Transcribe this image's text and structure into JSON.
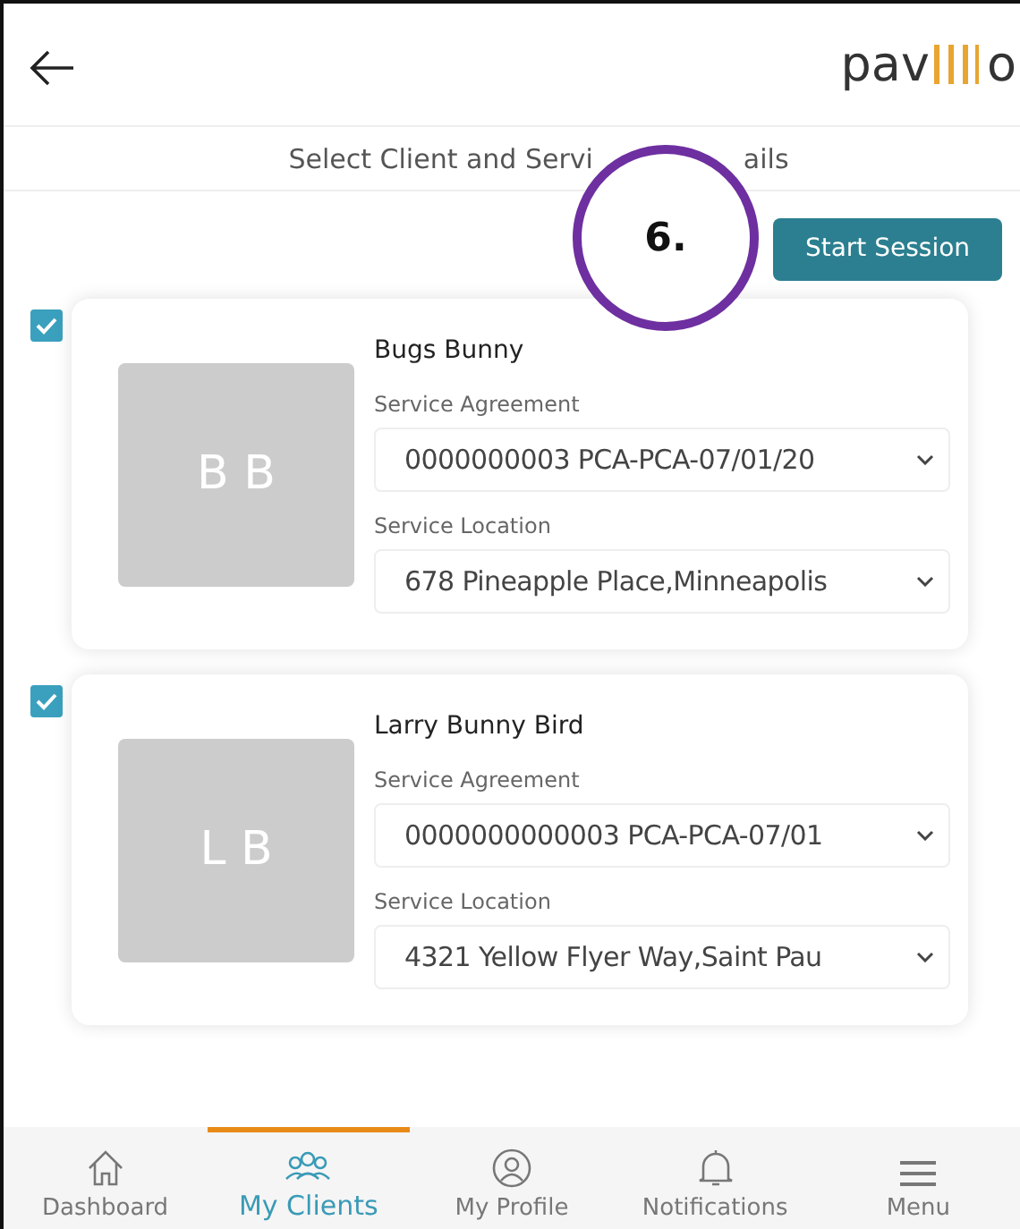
{
  "header": {
    "logo_start": "pav",
    "logo_end": "o"
  },
  "title_parts": [
    "Select Client and Servi",
    "ails"
  ],
  "annotation": {
    "label": "6."
  },
  "start_button": "Start Session",
  "clients": [
    {
      "name": "Bugs Bunny",
      "initials": "B B",
      "checked": true,
      "agreement_label": "Service Agreement",
      "agreement": "0000000003 PCA-PCA-07/01/20",
      "location_label": "Service Location",
      "location": "678 Pineapple Place,Minneapolis"
    },
    {
      "name": "Larry Bunny Bird",
      "initials": "L B",
      "checked": true,
      "agreement_label": "Service Agreement",
      "agreement": "0000000000003 PCA-PCA-07/01",
      "location_label": "Service Location",
      "location": "4321 Yellow Flyer Way,Saint Pau"
    }
  ],
  "nav": [
    {
      "kind": "home",
      "label": "Dashboard",
      "selected": false
    },
    {
      "kind": "clients",
      "label": "My Clients",
      "selected": true
    },
    {
      "kind": "profile",
      "label": "My Profile",
      "selected": false
    },
    {
      "kind": "bell",
      "label": "Notifications",
      "selected": false
    },
    {
      "kind": "menu",
      "label": "Menu",
      "selected": false
    }
  ]
}
